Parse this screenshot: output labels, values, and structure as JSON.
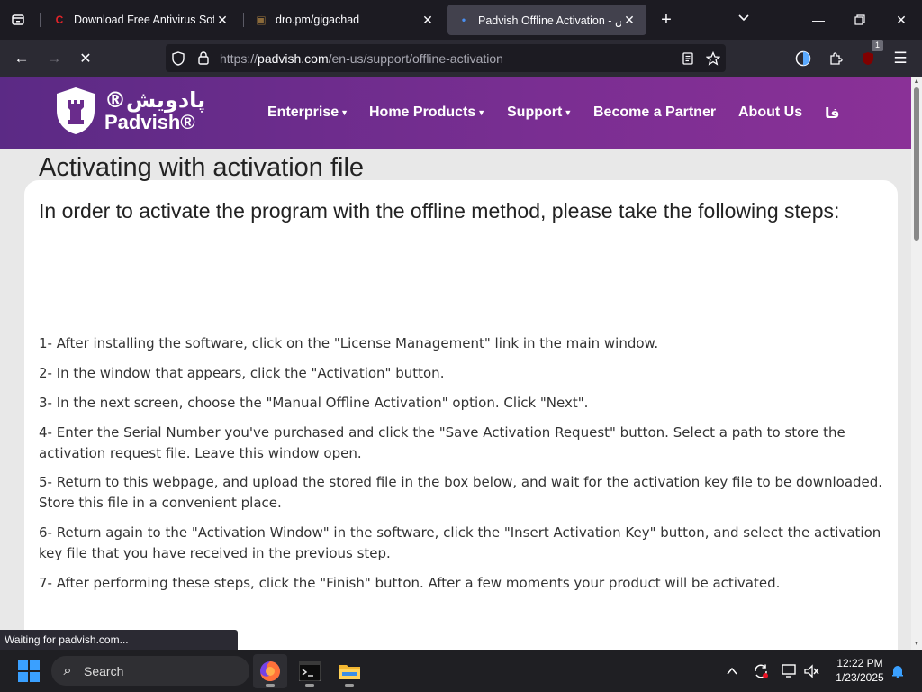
{
  "browser": {
    "tabs": [
      {
        "title": "Download Free Antivirus Software",
        "favicon": "C"
      },
      {
        "title": "dro.pm/gigachad",
        "favicon": "▣"
      },
      {
        "title": "Padvish Offline Activation - پادویش",
        "favicon": "•"
      }
    ],
    "url": {
      "prefix": "https://",
      "host": "padvish.com",
      "path": "/en-us/support/offline-activation"
    },
    "extension_badge": "1",
    "status": "Waiting for padvish.com..."
  },
  "site": {
    "logo_fa": "پادویش®",
    "logo_en": "Padvish®",
    "menu": [
      {
        "label": "Enterprise",
        "dropdown": true
      },
      {
        "label": "Home Products",
        "dropdown": true
      },
      {
        "label": "Support",
        "dropdown": true
      },
      {
        "label": "Become a Partner",
        "dropdown": false
      },
      {
        "label": "About Us",
        "dropdown": false
      },
      {
        "label": "فا",
        "dropdown": false
      }
    ],
    "colors": {
      "header_start": "#5b2a85",
      "header_end": "#8a3197"
    }
  },
  "content": {
    "heading": "Activating with activation file",
    "subheading": "In order to activate the program with the offline method, please take the following steps:",
    "steps": [
      "1- After installing the software, click on the \"License Management\" link in the main window.",
      "2- In the window that appears, click the \"Activation\" button.",
      "3- In the next screen, choose the \"Manual Offline Activation\" option. Click \"Next\".",
      "4- Enter the Serial Number you've purchased and click the \"Save Activation Request\" button. Select a path to store the activation request file. Leave this window open.",
      "5- Return to this webpage, and upload the stored file in the box below, and wait for the activation key file to be downloaded. Store this file in a convenient place.",
      "6- Return again to the \"Activation Window\" in the software, click the \"Insert Activation Key\" button, and select the activation key file that you have received in the previous step.",
      "7- After performing these steps, click the \"Finish\" button. After a few moments your product will be activated."
    ]
  },
  "taskbar": {
    "search_label": "Search",
    "time": "12:22 PM",
    "date": "1/23/2025"
  }
}
